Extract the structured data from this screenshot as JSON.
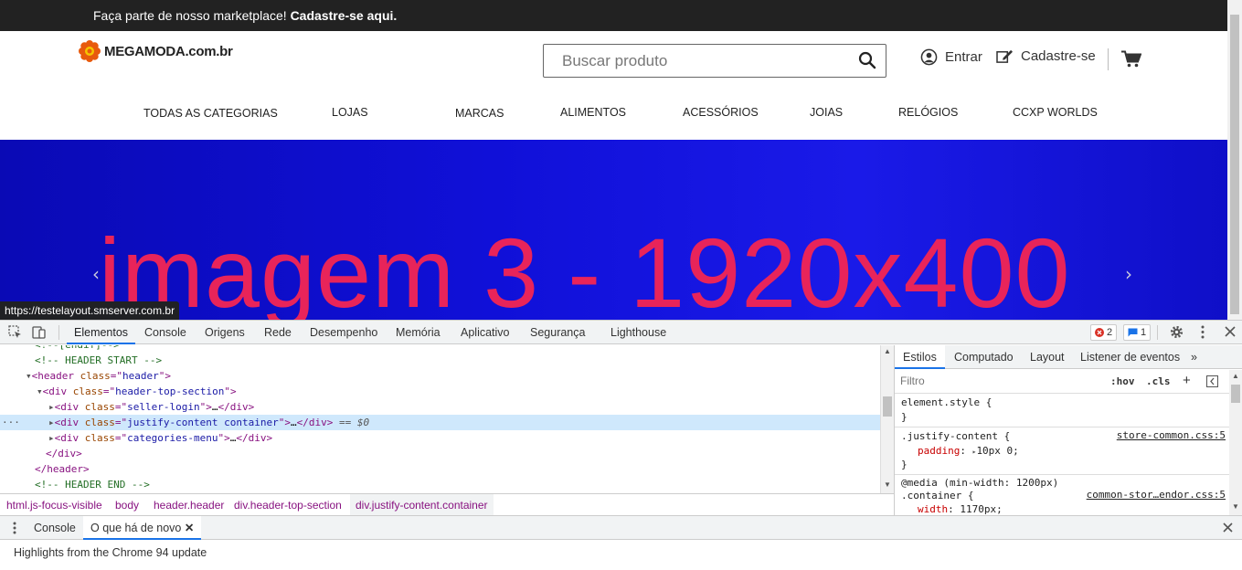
{
  "site": {
    "topbar": {
      "text": "Faça parte de nosso marketplace!",
      "link": "Cadastre-se aqui."
    },
    "logo": {
      "name": "MEGAMODA",
      "domain": ".com.br"
    },
    "search": {
      "placeholder": "Buscar produto"
    },
    "account": {
      "login": "Entrar",
      "register": "Cadastre-se"
    },
    "nav": [
      "TODAS AS CATEGORIAS",
      "LOJAS",
      "MARCAS",
      "ALIMENTOS",
      "ACESSÓRIOS",
      "JOIAS",
      "RELÓGIOS",
      "CCXP WORLDS"
    ],
    "banner": {
      "text": "imagem 3 - 1920x400",
      "prev": "‹",
      "next": "›"
    },
    "status_url": "https://testelayout.smserver.com.br",
    "colors": {
      "topbar": "#222222",
      "banner": "#1414d8",
      "banner_text": "#e8245a",
      "accent": "#1a73e8"
    }
  },
  "devtools": {
    "tabs": [
      "Elementos",
      "Console",
      "Origens",
      "Rede",
      "Desempenho",
      "Memória",
      "Aplicativo",
      "Segurança",
      "Lighthouse"
    ],
    "errors": "2",
    "messages": "1",
    "dom": {
      "partial_top": "<!--[endif]-->",
      "header_start": "<!-- HEADER START -->",
      "header_class": "header",
      "top_section_class": "header-top-section",
      "child1_class": "seller-login",
      "child2_class": "justify-content container",
      "child3_class": "categories-menu",
      "selected_suffix": "== $0",
      "header_end": "<!-- HEADER END -->",
      "ellipsis": "…",
      "dots": "···"
    },
    "breadcrumbs": [
      "html.js-focus-visible",
      "body",
      "header.header",
      "div.header-top-section",
      "div.justify-content.container"
    ],
    "styles": {
      "tabs": [
        "Estilos",
        "Computado",
        "Layout",
        "Listener de eventos",
        "»"
      ],
      "filter_placeholder": "Filtro",
      "hov": ":hov",
      "cls": ".cls",
      "rule1_selector": "element.style {",
      "rule2_selector": ".justify-content {",
      "rule2_prop": "padding",
      "rule2_value": "10px 0;",
      "rule2_src": "store-common.css:5",
      "rule3_media": "@media (min-width: 1200px)",
      "rule3_selector": ".container {",
      "rule3_prop": "width",
      "rule3_value": "1170px;",
      "rule3_src": "common-stor…endor.css:5",
      "close_brace": "}"
    },
    "drawer": {
      "tabs": [
        "Console",
        "O que há de novo"
      ],
      "content": "Highlights from the Chrome 94 update"
    }
  }
}
